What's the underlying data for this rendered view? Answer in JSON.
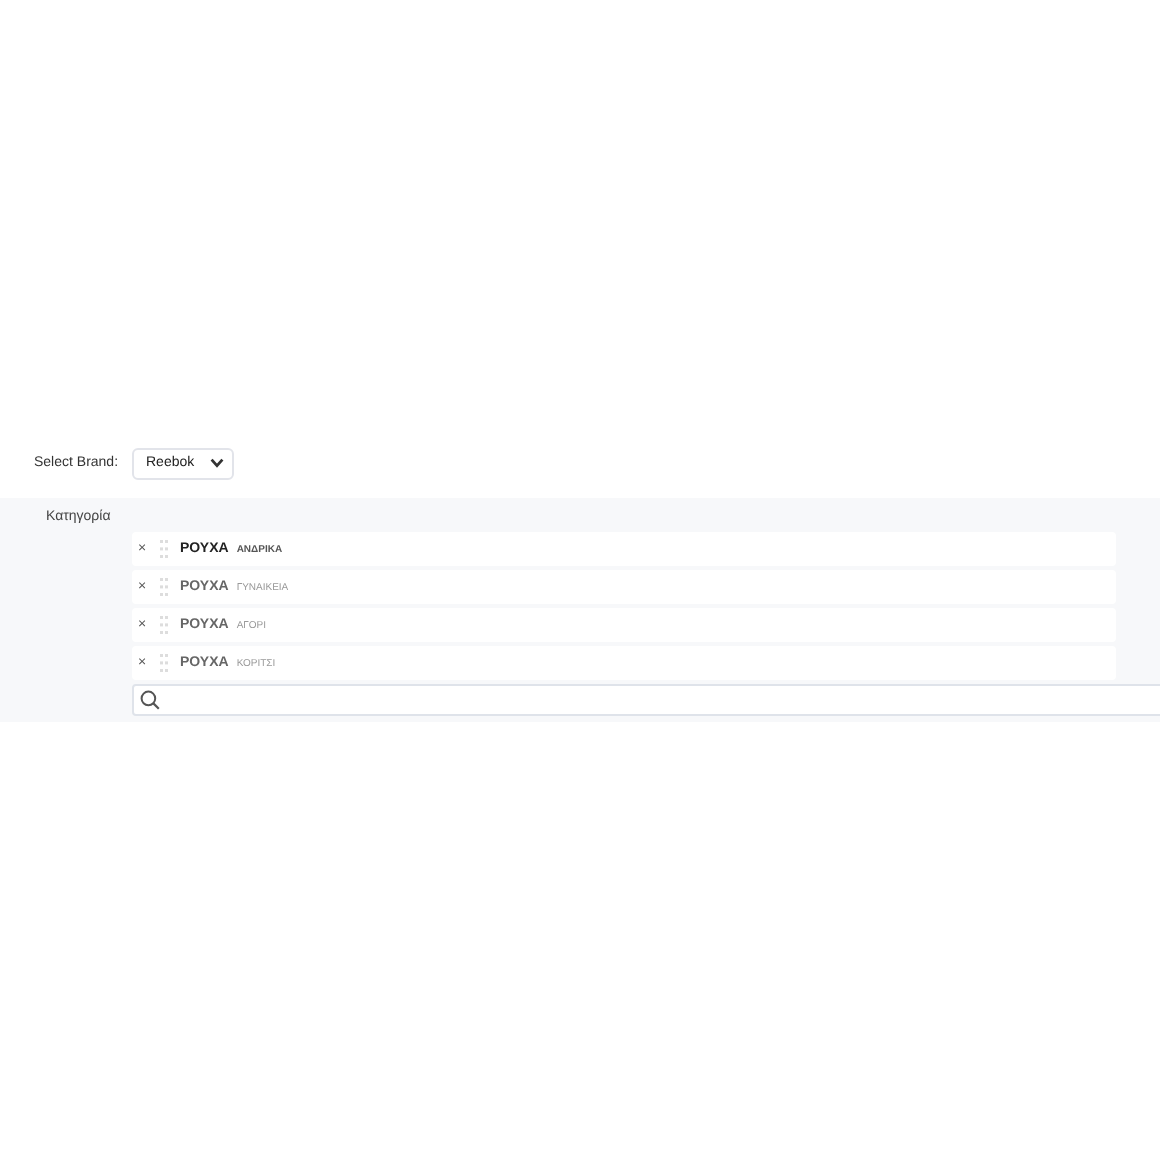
{
  "brand_select": {
    "label": "Select Brand:",
    "value": "Reebok"
  },
  "category": {
    "label": "Κατηγορία",
    "items": [
      {
        "remove": "×",
        "name": "ΡΟΥΧΑ",
        "sub": "ΑΝΔΡΙΚΑ",
        "selected": true
      },
      {
        "remove": "×",
        "name": "ΡΟΥΧΑ",
        "sub": "ΓΥΝΑΙΚΕΙΑ",
        "selected": false
      },
      {
        "remove": "×",
        "name": "ΡΟΥΧΑ",
        "sub": "ΑΓΟΡΙ",
        "selected": false
      },
      {
        "remove": "×",
        "name": "ΡΟΥΧΑ",
        "sub": "ΚΟΡΙΤΣΙ",
        "selected": false
      }
    ]
  }
}
